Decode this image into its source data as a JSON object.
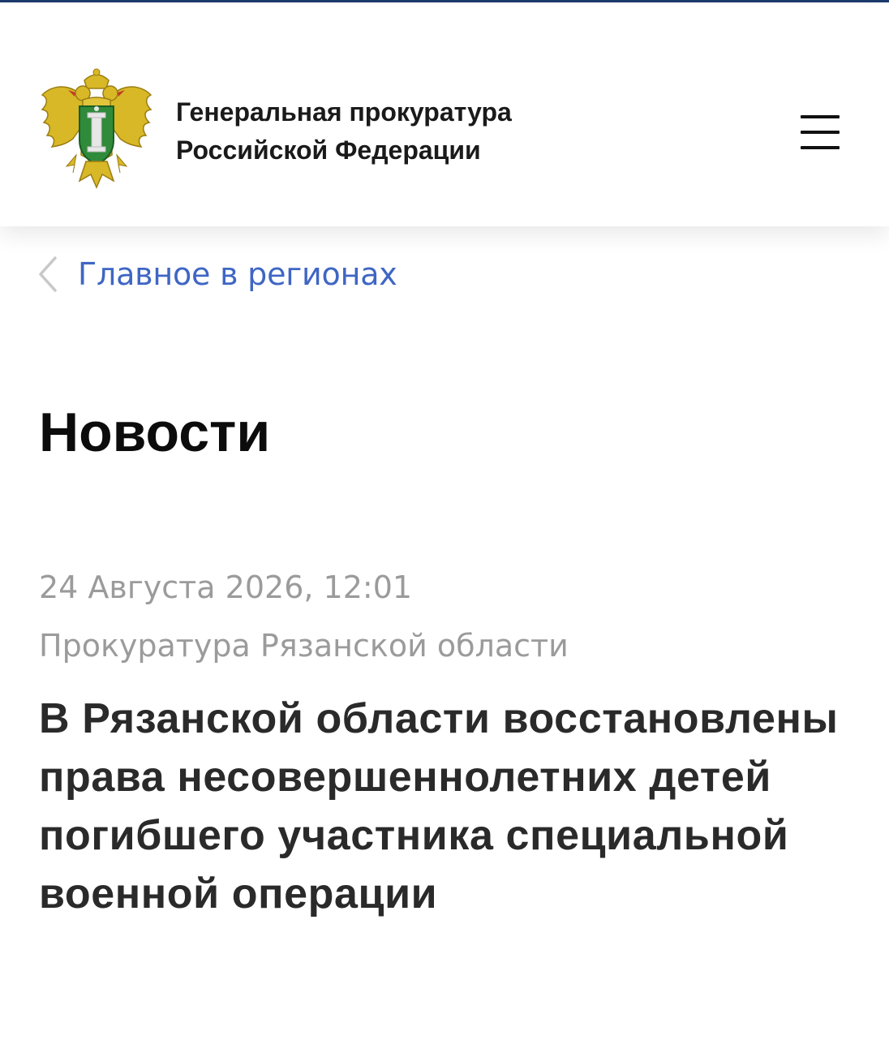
{
  "header": {
    "org_line1": "Генеральная прокуратура",
    "org_line2": "Российской Федерации",
    "emblem_icon": "prosecutor-emblem-icon",
    "menu_icon": "hamburger-menu-icon"
  },
  "breadcrumb": {
    "label": "Главное в регионах",
    "icon": "chevron-left-icon"
  },
  "page": {
    "title": "Новости"
  },
  "news": {
    "date": "24 Августа 2026, 12:01",
    "source": "Прокуратура Рязанской области",
    "headline": "В Рязанской области восстановлены права несовершеннолетних детей погибшего участника специальной военной операции"
  },
  "colors": {
    "top_strip": "#1d3a6e",
    "link": "#3f66c4",
    "meta_text": "#9b9b9b",
    "emblem_gold": "#d8b826",
    "emblem_green": "#2f8a3a"
  }
}
